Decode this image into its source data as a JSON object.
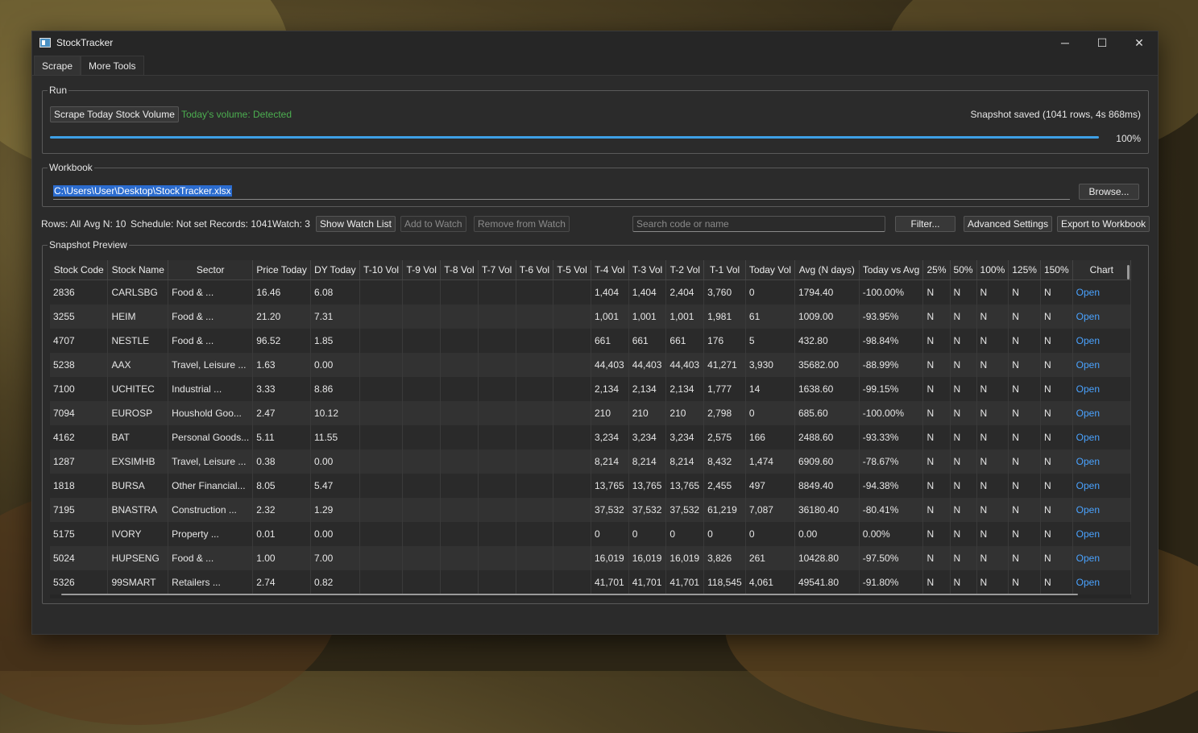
{
  "window": {
    "title": "StockTracker",
    "controls": [
      "─",
      "☐",
      "✕"
    ]
  },
  "tabs": [
    {
      "label": "Scrape",
      "active": true
    },
    {
      "label": "More Tools",
      "active": false
    }
  ],
  "run": {
    "group_label": "Run",
    "scrape_button": "Scrape Today Stock Volume",
    "status": "Today's volume: Detected",
    "status_color": "#4caf50",
    "snapshot_info": "Snapshot saved (1041 rows, 4s 868ms)",
    "progress_percent": 100,
    "progress_label": "100%"
  },
  "workbook": {
    "group_label": "Workbook",
    "path": "C:\\Users\\User\\Desktop\\StockTracker.xlsx",
    "browse_button": "Browse..."
  },
  "toolbar": {
    "rows": "Rows: All",
    "avg_n": "Avg N: 10",
    "schedule": "Schedule: Not set",
    "records": "Records: 1041",
    "watch": "Watch: 3",
    "show_watch": "Show Watch List",
    "add_watch": "Add to Watch",
    "remove_watch": "Remove from Watch",
    "search_placeholder": "Search code or name",
    "filter": "Filter...",
    "advanced": "Advanced Settings",
    "export": "Export to Workbook"
  },
  "snapshot": {
    "group_label": "Snapshot Preview",
    "columns": [
      "Stock Code",
      "Stock Name",
      "Sector",
      "Price Today",
      "DY Today",
      "T-10 Vol",
      "T-9 Vol",
      "T-8 Vol",
      "T-7 Vol",
      "T-6 Vol",
      "T-5 Vol",
      "T-4 Vol",
      "T-3 Vol",
      "T-2 Vol",
      "T-1 Vol",
      "Today Vol",
      "Avg (N days)",
      "Today vs Avg",
      "25%",
      "50%",
      "100%",
      "125%",
      "150%",
      "Chart"
    ],
    "rows": [
      [
        "2836",
        "CARLSBG",
        "Food & ...",
        "16.46",
        "6.08",
        "",
        "",
        "",
        "",
        "",
        "",
        "1,404",
        "1,404",
        "2,404",
        "3,760",
        "0",
        "1794.40",
        "-100.00%",
        "N",
        "N",
        "N",
        "N",
        "N",
        "Open"
      ],
      [
        "3255",
        "HEIM",
        "Food & ...",
        "21.20",
        "7.31",
        "",
        "",
        "",
        "",
        "",
        "",
        "1,001",
        "1,001",
        "1,001",
        "1,981",
        "61",
        "1009.00",
        "-93.95%",
        "N",
        "N",
        "N",
        "N",
        "N",
        "Open"
      ],
      [
        "4707",
        "NESTLE",
        "Food & ...",
        "96.52",
        "1.85",
        "",
        "",
        "",
        "",
        "",
        "",
        "661",
        "661",
        "661",
        "176",
        "5",
        "432.80",
        "-98.84%",
        "N",
        "N",
        "N",
        "N",
        "N",
        "Open"
      ],
      [
        "5238",
        "AAX",
        "Travel, Leisure ...",
        "1.63",
        "0.00",
        "",
        "",
        "",
        "",
        "",
        "",
        "44,403",
        "44,403",
        "44,403",
        "41,271",
        "3,930",
        "35682.00",
        "-88.99%",
        "N",
        "N",
        "N",
        "N",
        "N",
        "Open"
      ],
      [
        "7100",
        "UCHITEC",
        "Industrial ...",
        "3.33",
        "8.86",
        "",
        "",
        "",
        "",
        "",
        "",
        "2,134",
        "2,134",
        "2,134",
        "1,777",
        "14",
        "1638.60",
        "-99.15%",
        "N",
        "N",
        "N",
        "N",
        "N",
        "Open"
      ],
      [
        "7094",
        "EUROSP",
        "Houshold Goo...",
        "2.47",
        "10.12",
        "",
        "",
        "",
        "",
        "",
        "",
        "210",
        "210",
        "210",
        "2,798",
        "0",
        "685.60",
        "-100.00%",
        "N",
        "N",
        "N",
        "N",
        "N",
        "Open"
      ],
      [
        "4162",
        "BAT",
        "Personal Goods...",
        "5.11",
        "11.55",
        "",
        "",
        "",
        "",
        "",
        "",
        "3,234",
        "3,234",
        "3,234",
        "2,575",
        "166",
        "2488.60",
        "-93.33%",
        "N",
        "N",
        "N",
        "N",
        "N",
        "Open"
      ],
      [
        "1287",
        "EXSIMHB",
        "Travel, Leisure ...",
        "0.38",
        "0.00",
        "",
        "",
        "",
        "",
        "",
        "",
        "8,214",
        "8,214",
        "8,214",
        "8,432",
        "1,474",
        "6909.60",
        "-78.67%",
        "N",
        "N",
        "N",
        "N",
        "N",
        "Open"
      ],
      [
        "1818",
        "BURSA",
        "Other Financial...",
        "8.05",
        "5.47",
        "",
        "",
        "",
        "",
        "",
        "",
        "13,765",
        "13,765",
        "13,765",
        "2,455",
        "497",
        "8849.40",
        "-94.38%",
        "N",
        "N",
        "N",
        "N",
        "N",
        "Open"
      ],
      [
        "7195",
        "BNASTRA",
        "Construction ...",
        "2.32",
        "1.29",
        "",
        "",
        "",
        "",
        "",
        "",
        "37,532",
        "37,532",
        "37,532",
        "61,219",
        "7,087",
        "36180.40",
        "-80.41%",
        "N",
        "N",
        "N",
        "N",
        "N",
        "Open"
      ],
      [
        "5175",
        "IVORY",
        "Property ...",
        "0.01",
        "0.00",
        "",
        "",
        "",
        "",
        "",
        "",
        "0",
        "0",
        "0",
        "0",
        "0",
        "0.00",
        "0.00%",
        "N",
        "N",
        "N",
        "N",
        "N",
        "Open"
      ],
      [
        "5024",
        "HUPSENG",
        "Food & ...",
        "1.00",
        "7.00",
        "",
        "",
        "",
        "",
        "",
        "",
        "16,019",
        "16,019",
        "16,019",
        "3,826",
        "261",
        "10428.80",
        "-97.50%",
        "N",
        "N",
        "N",
        "N",
        "N",
        "Open"
      ],
      [
        "5326",
        "99SMART",
        "Retailers ...",
        "2.74",
        "0.82",
        "",
        "",
        "",
        "",
        "",
        "",
        "41,701",
        "41,701",
        "41,701",
        "118,545",
        "4,061",
        "49541.80",
        "-91.80%",
        "N",
        "N",
        "N",
        "N",
        "N",
        "Open"
      ]
    ]
  }
}
